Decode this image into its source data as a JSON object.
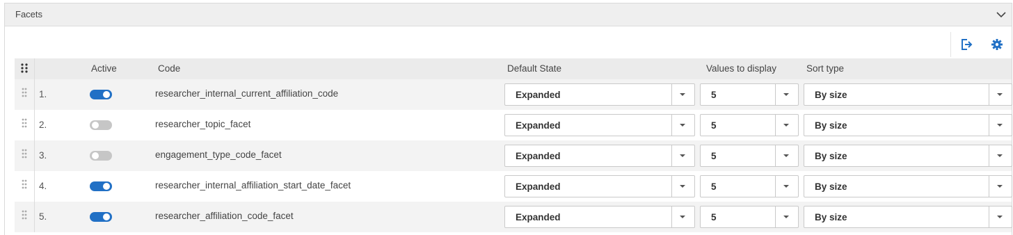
{
  "panel": {
    "title": "Facets"
  },
  "toolbar": {
    "export_icon": "export-icon",
    "settings_icon": "gear-icon"
  },
  "colors": {
    "accent": "#2170c5",
    "toggle_off": "#c6c6c6",
    "header_bg": "#ebebeb",
    "row_alt_bg": "#f3f3f3"
  },
  "table": {
    "columns": {
      "active": "Active",
      "code": "Code",
      "default_state": "Default State",
      "values_to_display": "Values to display",
      "sort_type": "Sort type"
    },
    "rows": [
      {
        "num": "1.",
        "active": true,
        "code": "researcher_internal_current_affiliation_code",
        "default_state": "Expanded",
        "values_to_display": "5",
        "sort_type": "By size"
      },
      {
        "num": "2.",
        "active": false,
        "code": "researcher_topic_facet",
        "default_state": "Expanded",
        "values_to_display": "5",
        "sort_type": "By size"
      },
      {
        "num": "3.",
        "active": false,
        "code": "engagement_type_code_facet",
        "default_state": "Expanded",
        "values_to_display": "5",
        "sort_type": "By size"
      },
      {
        "num": "4.",
        "active": true,
        "code": "researcher_internal_affiliation_start_date_facet",
        "default_state": "Expanded",
        "values_to_display": "5",
        "sort_type": "By size"
      },
      {
        "num": "5.",
        "active": true,
        "code": "researcher_affiliation_code_facet",
        "default_state": "Expanded",
        "values_to_display": "5",
        "sort_type": "By size"
      }
    ]
  }
}
